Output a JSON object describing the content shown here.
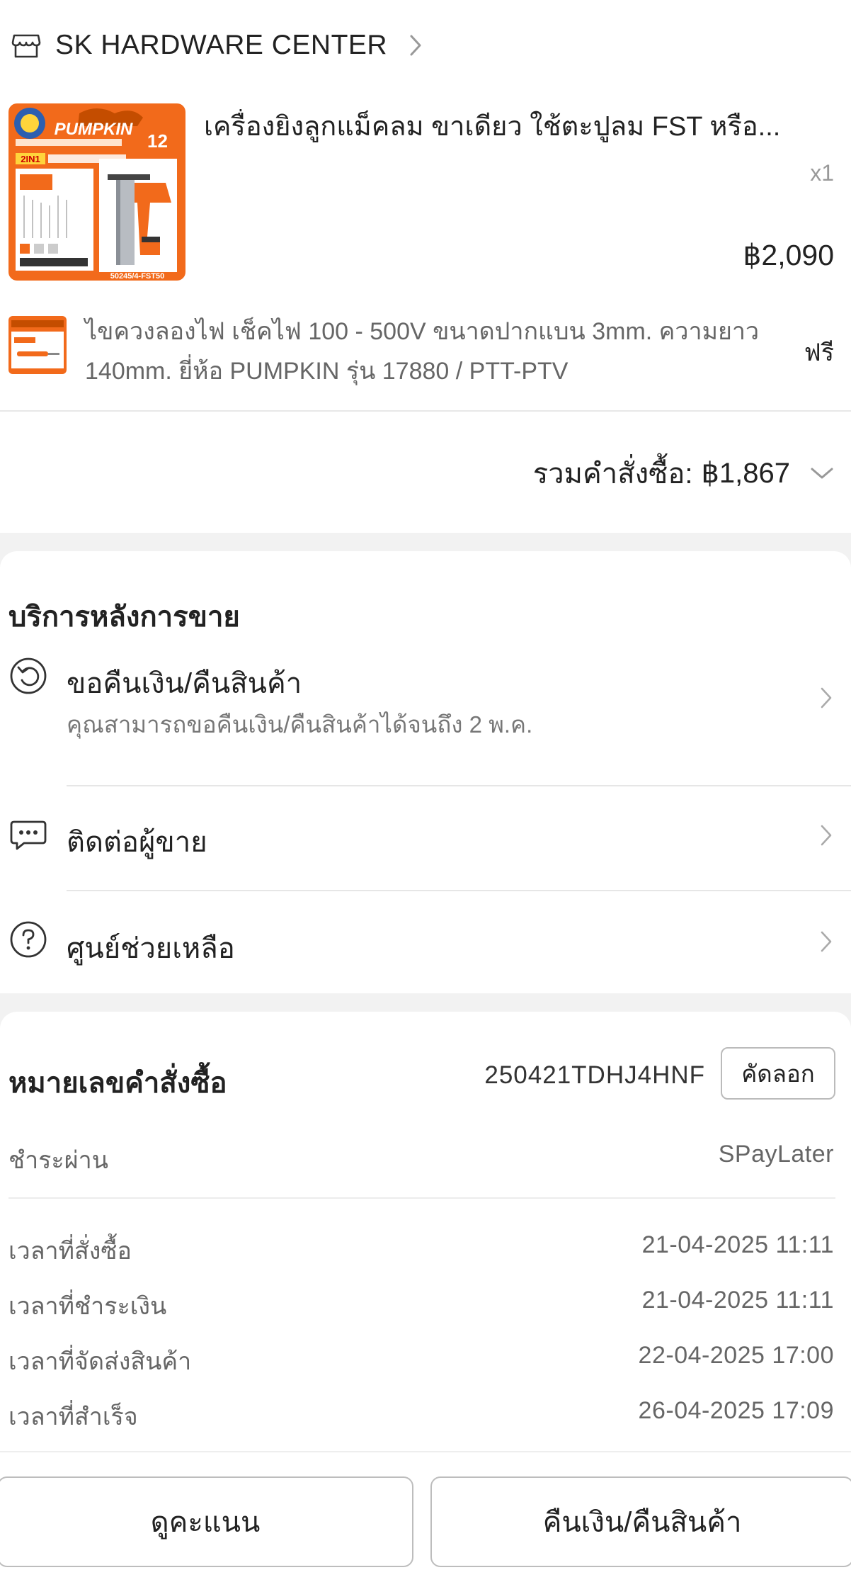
{
  "shop": {
    "name": "SK HARDWARE CENTER",
    "icon": "shop-icon"
  },
  "product": {
    "title": "เครื่องยิงลูกแม็คลม ขาเดียว ใช้ตะปูลม FST หรือ...",
    "qty": "x1",
    "price": "฿2,090",
    "image": {
      "brand": "PUMPKIN",
      "badge": "2IN1",
      "model": "50245/4-FST50",
      "warranty": "12"
    }
  },
  "gift": {
    "title": "ไขควงลองไฟ เช็คไฟ 100 - 500V ขนาดปากแบน 3mm. ความยาว 140mm. ยี่ห้อ PUMPKIN รุ่น 17880 / PTT-PTV",
    "price": "ฟรี"
  },
  "order_total": {
    "label": "รวมคำสั่งซื้อ:",
    "amount": "฿1,867"
  },
  "after_sales": {
    "title": "บริการหลังการขาย",
    "items": [
      {
        "label": "ขอคืนเงิน/คืนสินค้า",
        "sub": "คุณสามารถขอคืนเงิน/คืนสินค้าได้จนถึง 2 พ.ค.",
        "icon": "return-icon"
      },
      {
        "label": "ติดต่อผู้ขาย",
        "icon": "chat-icon"
      },
      {
        "label": "ศูนย์ช่วยเหลือ",
        "icon": "help-icon"
      }
    ]
  },
  "order_info": {
    "order_no_label": "หมายเลขคำสั่งซื้อ",
    "order_no": "250421TDHJ4HNF",
    "copy_label": "คัดลอก",
    "payment_label": "ชำระผ่าน",
    "payment_value": "SPayLater",
    "times": [
      {
        "label": "เวลาที่สั่งซื้อ",
        "value": "21-04-2025 11:11"
      },
      {
        "label": "เวลาที่ชำระเงิน",
        "value": "21-04-2025 11:11"
      },
      {
        "label": "เวลาที่จัดส่งสินค้า",
        "value": "22-04-2025 17:00"
      },
      {
        "label": "เวลาที่สำเร็จ",
        "value": "26-04-2025 17:09"
      }
    ]
  },
  "actions": {
    "rate_label": "ดูคะแนน",
    "return_label": "คืนเงิน/คืนสินค้า"
  },
  "colors": {
    "brand_orange": "#f26a1b",
    "text": "#222222",
    "muted": "#666666"
  }
}
